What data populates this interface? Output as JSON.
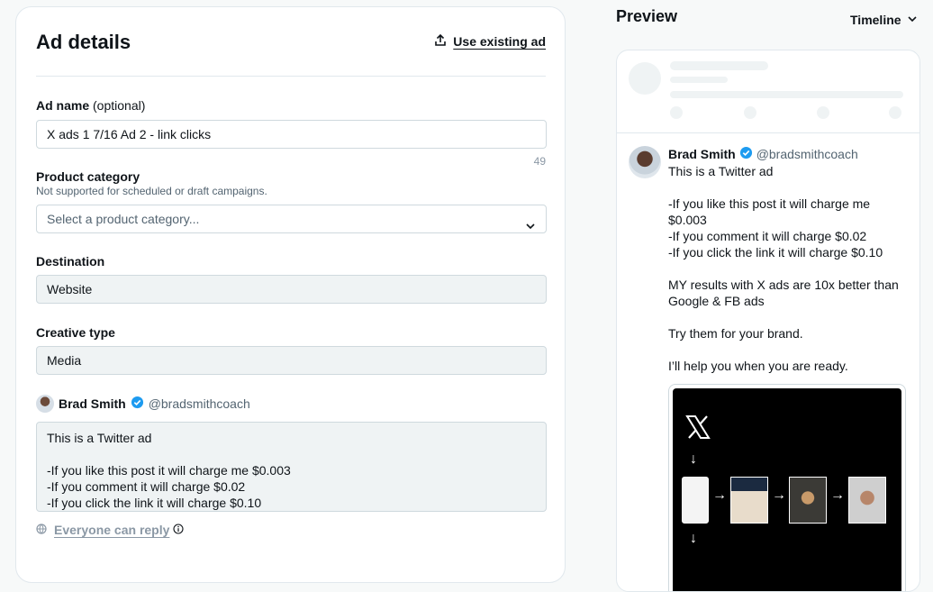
{
  "ad_details": {
    "title": "Ad details",
    "use_existing": "Use existing ad",
    "ad_name": {
      "label": "Ad name",
      "optional": "(optional)",
      "value": "X ads 1 7/16 Ad 2 - link clicks",
      "counter": "49"
    },
    "product_category": {
      "label": "Product category",
      "hint": "Not supported for scheduled or draft campaigns.",
      "placeholder": "Select a product category..."
    },
    "destination": {
      "label": "Destination",
      "value": "Website"
    },
    "creative_type": {
      "label": "Creative type",
      "value": "Media"
    },
    "author": {
      "name": "Brad Smith",
      "handle": "@bradsmithcoach"
    },
    "tweet_lines": [
      "This is a Twitter ad",
      "",
      "-If you like this post it will charge me $0.003",
      "-If you comment it will charge $0.02",
      "-If you click the link it will charge $0.10"
    ],
    "reply_setting": "Everyone can reply"
  },
  "preview": {
    "title": "Preview",
    "placement": "Timeline",
    "author": {
      "name": "Brad Smith",
      "handle": "@bradsmithcoach"
    },
    "tweet_lines": [
      "This is a Twitter ad",
      "",
      "-If you like this post it will charge me",
      "$0.003",
      "-If you comment it will charge $0.02",
      "-If you click the link it will charge $0.10",
      "",
      "MY results with X ads are 10x better than",
      "Google & FB ads",
      "",
      "Try them for your brand.",
      "",
      "I’ll help you when you are ready."
    ]
  },
  "colors": {
    "verified": "#1d9bf0",
    "text": "#0f1419",
    "muted": "#536471"
  },
  "icons": [
    "upload-icon",
    "chevron-down-icon",
    "verified-badge-icon",
    "globe-icon",
    "info-icon",
    "x-logo-icon"
  ]
}
